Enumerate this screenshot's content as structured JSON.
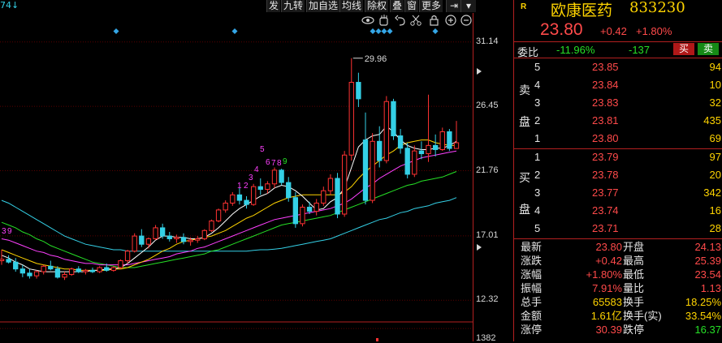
{
  "toolbar": {
    "corner_label": "74↓",
    "buttons": [
      "发",
      "九转",
      "加自选",
      "均线",
      "除权",
      "叠",
      "窗",
      "更多"
    ],
    "icons": [
      "eye-icon",
      "hand-icon",
      "undo-icon",
      "scissors-icon",
      "lock-icon",
      "zoom-in-icon",
      "zoom-out-icon"
    ]
  },
  "chart": {
    "y_ticks": [
      "31.14",
      "26.45",
      "21.76",
      "17.01",
      "12.32",
      "1382"
    ],
    "peak_label": "29.96",
    "sequence_numbers": [
      "3",
      "9",
      "1",
      "2",
      "3",
      "4",
      "5",
      "6",
      "7",
      "8",
      "9"
    ],
    "colors": {
      "up": "#ff3232",
      "down": "#34d0e6",
      "ma5": "#ffffff",
      "ma10": "#ffd400",
      "ma20": "#ff40ff",
      "ma30": "#26e026",
      "ma60": "#34d0e6",
      "grid": "#5a0000"
    }
  },
  "chart_data": {
    "type": "candlestick",
    "ylim": [
      10.8,
      32.9
    ],
    "candles": [
      {
        "o": 15.2,
        "h": 16.0,
        "l": 14.9,
        "c": 15.3
      },
      {
        "o": 15.3,
        "h": 15.6,
        "l": 15.0,
        "c": 15.1
      },
      {
        "o": 15.1,
        "h": 15.4,
        "l": 14.4,
        "c": 14.6
      },
      {
        "o": 14.6,
        "h": 14.9,
        "l": 14.0,
        "c": 14.3
      },
      {
        "o": 14.3,
        "h": 14.6,
        "l": 13.9,
        "c": 14.1
      },
      {
        "o": 14.1,
        "h": 14.5,
        "l": 13.9,
        "c": 14.4
      },
      {
        "o": 14.4,
        "h": 14.9,
        "l": 14.2,
        "c": 14.8
      },
      {
        "o": 14.8,
        "h": 15.2,
        "l": 14.5,
        "c": 14.6
      },
      {
        "o": 14.6,
        "h": 14.8,
        "l": 13.9,
        "c": 14.0
      },
      {
        "o": 14.0,
        "h": 14.4,
        "l": 13.8,
        "c": 14.2
      },
      {
        "o": 14.2,
        "h": 14.7,
        "l": 14.1,
        "c": 14.6
      },
      {
        "o": 14.6,
        "h": 14.8,
        "l": 14.3,
        "c": 14.4
      },
      {
        "o": 14.4,
        "h": 14.6,
        "l": 14.2,
        "c": 14.5
      },
      {
        "o": 14.5,
        "h": 14.7,
        "l": 14.3,
        "c": 14.4
      },
      {
        "o": 14.4,
        "h": 14.8,
        "l": 14.3,
        "c": 14.7
      },
      {
        "o": 14.7,
        "h": 15.0,
        "l": 14.4,
        "c": 14.5
      },
      {
        "o": 14.5,
        "h": 14.8,
        "l": 14.4,
        "c": 14.7
      },
      {
        "o": 14.7,
        "h": 15.3,
        "l": 14.6,
        "c": 15.2
      },
      {
        "o": 15.2,
        "h": 16.0,
        "l": 15.0,
        "c": 15.9
      },
      {
        "o": 15.9,
        "h": 17.2,
        "l": 15.8,
        "c": 17.0
      },
      {
        "o": 17.0,
        "h": 17.5,
        "l": 16.2,
        "c": 16.4
      },
      {
        "o": 16.4,
        "h": 16.9,
        "l": 16.1,
        "c": 16.8
      },
      {
        "o": 16.8,
        "h": 17.8,
        "l": 16.7,
        "c": 17.6
      },
      {
        "o": 17.6,
        "h": 17.9,
        "l": 16.8,
        "c": 17.0
      },
      {
        "o": 17.0,
        "h": 17.3,
        "l": 16.6,
        "c": 16.8
      },
      {
        "o": 16.8,
        "h": 17.1,
        "l": 16.5,
        "c": 16.9
      },
      {
        "o": 16.9,
        "h": 17.2,
        "l": 16.4,
        "c": 16.6
      },
      {
        "o": 16.6,
        "h": 16.9,
        "l": 16.3,
        "c": 16.7
      },
      {
        "o": 16.7,
        "h": 17.0,
        "l": 16.5,
        "c": 16.8
      },
      {
        "o": 16.8,
        "h": 17.5,
        "l": 16.7,
        "c": 17.4
      },
      {
        "o": 17.4,
        "h": 18.2,
        "l": 17.3,
        "c": 18.1
      },
      {
        "o": 18.1,
        "h": 19.0,
        "l": 18.0,
        "c": 18.9
      },
      {
        "o": 18.9,
        "h": 19.6,
        "l": 18.7,
        "c": 19.4
      },
      {
        "o": 19.4,
        "h": 20.2,
        "l": 19.2,
        "c": 20.0
      },
      {
        "o": 20.0,
        "h": 20.5,
        "l": 19.3,
        "c": 19.6
      },
      {
        "o": 19.6,
        "h": 19.9,
        "l": 19.0,
        "c": 19.3
      },
      {
        "o": 19.3,
        "h": 20.8,
        "l": 19.2,
        "c": 20.6
      },
      {
        "o": 20.6,
        "h": 21.2,
        "l": 20.0,
        "c": 20.4
      },
      {
        "o": 20.4,
        "h": 21.0,
        "l": 20.1,
        "c": 20.8
      },
      {
        "o": 20.8,
        "h": 22.0,
        "l": 20.5,
        "c": 21.8
      },
      {
        "o": 21.8,
        "h": 21.9,
        "l": 20.7,
        "c": 20.9
      },
      {
        "o": 20.9,
        "h": 21.3,
        "l": 19.5,
        "c": 19.8
      },
      {
        "o": 19.8,
        "h": 20.2,
        "l": 17.6,
        "c": 17.9
      },
      {
        "o": 17.9,
        "h": 19.3,
        "l": 17.7,
        "c": 19.1
      },
      {
        "o": 19.1,
        "h": 19.5,
        "l": 18.6,
        "c": 18.8
      },
      {
        "o": 18.8,
        "h": 19.7,
        "l": 18.5,
        "c": 19.4
      },
      {
        "o": 19.4,
        "h": 20.6,
        "l": 19.2,
        "c": 20.3
      },
      {
        "o": 20.3,
        "h": 21.5,
        "l": 20.0,
        "c": 21.2
      },
      {
        "o": 21.2,
        "h": 21.6,
        "l": 18.3,
        "c": 18.6
      },
      {
        "o": 18.6,
        "h": 23.2,
        "l": 18.4,
        "c": 22.9
      },
      {
        "o": 22.9,
        "h": 29.96,
        "l": 22.5,
        "c": 28.2
      },
      {
        "o": 28.2,
        "h": 28.9,
        "l": 26.4,
        "c": 27.0
      },
      {
        "o": 24.0,
        "h": 26.0,
        "l": 19.3,
        "c": 19.6
      },
      {
        "o": 19.6,
        "h": 24.5,
        "l": 19.4,
        "c": 23.9
      },
      {
        "o": 23.9,
        "h": 25.0,
        "l": 22.0,
        "c": 22.5
      },
      {
        "o": 22.5,
        "h": 27.2,
        "l": 22.3,
        "c": 26.8
      },
      {
        "o": 26.8,
        "h": 27.0,
        "l": 24.0,
        "c": 24.3
      },
      {
        "o": 24.3,
        "h": 24.8,
        "l": 23.0,
        "c": 23.4
      },
      {
        "o": 23.4,
        "h": 23.8,
        "l": 21.2,
        "c": 21.5
      },
      {
        "o": 21.5,
        "h": 23.6,
        "l": 21.3,
        "c": 23.2
      },
      {
        "o": 23.2,
        "h": 23.9,
        "l": 22.6,
        "c": 23.0
      },
      {
        "o": 23.0,
        "h": 27.3,
        "l": 22.4,
        "c": 23.6
      },
      {
        "o": 23.6,
        "h": 24.4,
        "l": 22.8,
        "c": 23.3
      },
      {
        "o": 23.3,
        "h": 24.9,
        "l": 23.2,
        "c": 24.6
      },
      {
        "o": 24.6,
        "h": 24.8,
        "l": 23.2,
        "c": 23.38
      },
      {
        "o": 23.38,
        "h": 25.39,
        "l": 23.54,
        "c": 23.8
      }
    ],
    "ma5": [
      15.6,
      15.4,
      15.1,
      14.9,
      14.6,
      14.5,
      14.4,
      14.4,
      14.4,
      14.4,
      14.4,
      14.4,
      14.4,
      14.5,
      14.5,
      14.6,
      14.6,
      14.7,
      15.0,
      15.4,
      15.8,
      16.2,
      16.7,
      17.0,
      17.0,
      16.9,
      16.9,
      16.8,
      16.8,
      16.9,
      17.2,
      17.6,
      18.1,
      18.6,
      19.0,
      19.3,
      19.6,
      19.9,
      20.1,
      20.5,
      20.7,
      20.6,
      20.3,
      19.9,
      19.4,
      18.9,
      19.0,
      19.5,
      19.8,
      20.5,
      22.0,
      23.5,
      24.0,
      24.3,
      24.4,
      25.0,
      24.6,
      24.0,
      23.6,
      23.4,
      23.3,
      23.3,
      23.4,
      23.4,
      23.6,
      23.9
    ],
    "ma10": [
      16.0,
      15.8,
      15.6,
      15.4,
      15.2,
      15.0,
      14.9,
      14.8,
      14.7,
      14.6,
      14.6,
      14.5,
      14.5,
      14.5,
      14.5,
      14.5,
      14.6,
      14.6,
      14.7,
      14.9,
      15.1,
      15.3,
      15.6,
      15.9,
      16.1,
      16.4,
      16.6,
      16.7,
      16.8,
      16.9,
      17.0,
      17.2,
      17.4,
      17.7,
      18.0,
      18.3,
      18.5,
      18.8,
      19.1,
      19.4,
      19.6,
      19.8,
      19.9,
      20.0,
      20.0,
      20.0,
      20.0,
      20.0,
      20.0,
      20.2,
      20.6,
      21.2,
      21.7,
      22.1,
      22.5,
      22.9,
      23.2,
      23.6,
      23.8,
      23.9,
      24.0,
      24.0,
      23.8,
      23.7,
      23.6,
      23.6
    ],
    "ma20": [
      16.8,
      16.7,
      16.5,
      16.3,
      16.1,
      15.9,
      15.8,
      15.6,
      15.5,
      15.3,
      15.2,
      15.1,
      15.0,
      15.0,
      14.9,
      14.9,
      14.9,
      14.9,
      14.9,
      15.0,
      15.1,
      15.2,
      15.3,
      15.4,
      15.5,
      15.7,
      15.8,
      15.9,
      16.1,
      16.2,
      16.4,
      16.6,
      16.8,
      17.0,
      17.2,
      17.4,
      17.6,
      17.8,
      18.0,
      18.2,
      18.3,
      18.4,
      18.5,
      18.6,
      18.7,
      18.8,
      18.9,
      19.0,
      19.2,
      19.4,
      19.7,
      20.1,
      20.5,
      20.8,
      21.2,
      21.5,
      21.8,
      22.1,
      22.3,
      22.5,
      22.7,
      22.8,
      22.9,
      23.0,
      23.1,
      23.2
    ],
    "ma30": [
      18.0,
      17.8,
      17.6,
      17.3,
      17.1,
      16.8,
      16.6,
      16.3,
      16.1,
      15.9,
      15.7,
      15.5,
      15.3,
      15.1,
      15.0,
      14.9,
      14.8,
      14.7,
      14.7,
      14.7,
      14.8,
      14.9,
      15.0,
      15.1,
      15.2,
      15.3,
      15.4,
      15.5,
      15.6,
      15.7,
      15.9,
      16.0,
      16.2,
      16.4,
      16.6,
      16.8,
      17.0,
      17.2,
      17.4,
      17.6,
      17.8,
      17.9,
      18.0,
      18.1,
      18.2,
      18.3,
      18.4,
      18.5,
      18.7,
      18.9,
      19.1,
      19.3,
      19.5,
      19.7,
      19.9,
      20.1,
      20.3,
      20.5,
      20.7,
      20.8,
      21.0,
      21.1,
      21.2,
      21.3,
      21.5,
      21.7
    ],
    "ma60": [
      19.6,
      19.4,
      19.1,
      18.8,
      18.5,
      18.2,
      17.9,
      17.6,
      17.3,
      17.0,
      16.8,
      16.6,
      16.4,
      16.3,
      16.2,
      16.1,
      16.0,
      16.0,
      15.9,
      15.9,
      15.9,
      15.9,
      15.9,
      15.9,
      15.9,
      15.9,
      15.9,
      15.9,
      15.9,
      15.9,
      15.9,
      15.9,
      15.9,
      15.9,
      15.9,
      15.9,
      15.95,
      16.0,
      16.0,
      16.05,
      16.1,
      16.2,
      16.3,
      16.4,
      16.5,
      16.6,
      16.7,
      16.8,
      17.0,
      17.2,
      17.4,
      17.6,
      17.8,
      18.0,
      18.2,
      18.3,
      18.5,
      18.7,
      18.8,
      19.0,
      19.1,
      19.2,
      19.4,
      19.5,
      19.6,
      19.8
    ]
  },
  "quote": {
    "market_tag": "R",
    "stock_name": "欧康医药",
    "stock_code": "833230",
    "last_price": "23.80",
    "change": "+0.42",
    "change_pct": "+1.80%",
    "weibi_label": "委比",
    "weibi_pct": "-11.96%",
    "weiicha": "-137",
    "buy_btn": "买",
    "sell_btn": "卖",
    "sell_side_label": [
      "卖",
      "盘"
    ],
    "buy_side_label": [
      "买",
      "盘"
    ],
    "asks": [
      {
        "level": "5",
        "price": "23.85",
        "vol": "94"
      },
      {
        "level": "4",
        "price": "23.84",
        "vol": "10"
      },
      {
        "level": "3",
        "price": "23.83",
        "vol": "32"
      },
      {
        "level": "2",
        "price": "23.81",
        "vol": "435"
      },
      {
        "level": "1",
        "price": "23.80",
        "vol": "69"
      }
    ],
    "bids": [
      {
        "level": "1",
        "price": "23.79",
        "vol": "97"
      },
      {
        "level": "2",
        "price": "23.78",
        "vol": "20"
      },
      {
        "level": "3",
        "price": "23.77",
        "vol": "342"
      },
      {
        "level": "4",
        "price": "23.74",
        "vol": "16"
      },
      {
        "level": "5",
        "price": "23.71",
        "vol": "28"
      }
    ],
    "stats": [
      {
        "l": "最新",
        "lv": "23.80",
        "lc": "r",
        "r": "开盘",
        "rv": "24.13",
        "rc": "r"
      },
      {
        "l": "涨跌",
        "lv": "+0.42",
        "lc": "r",
        "r": "最高",
        "rv": "25.39",
        "rc": "r"
      },
      {
        "l": "涨幅",
        "lv": "+1.80%",
        "lc": "r",
        "r": "最低",
        "rv": "23.54",
        "rc": "r"
      },
      {
        "l": "振幅",
        "lv": "7.91%",
        "lc": "r",
        "r": "量比",
        "rv": "1.13",
        "rc": "r"
      },
      {
        "l": "总手",
        "lv": "65583",
        "lc": "y",
        "r": "换手",
        "rv": "18.25%",
        "rc": "y"
      },
      {
        "l": "金额",
        "lv": "1.61亿",
        "lc": "y",
        "r": "换手(实)",
        "rv": "33.54%",
        "rc": "y"
      },
      {
        "l": "涨停",
        "lv": "30.39",
        "lc": "r",
        "r": "跌停",
        "rv": "16.37",
        "rc": "g"
      }
    ]
  }
}
